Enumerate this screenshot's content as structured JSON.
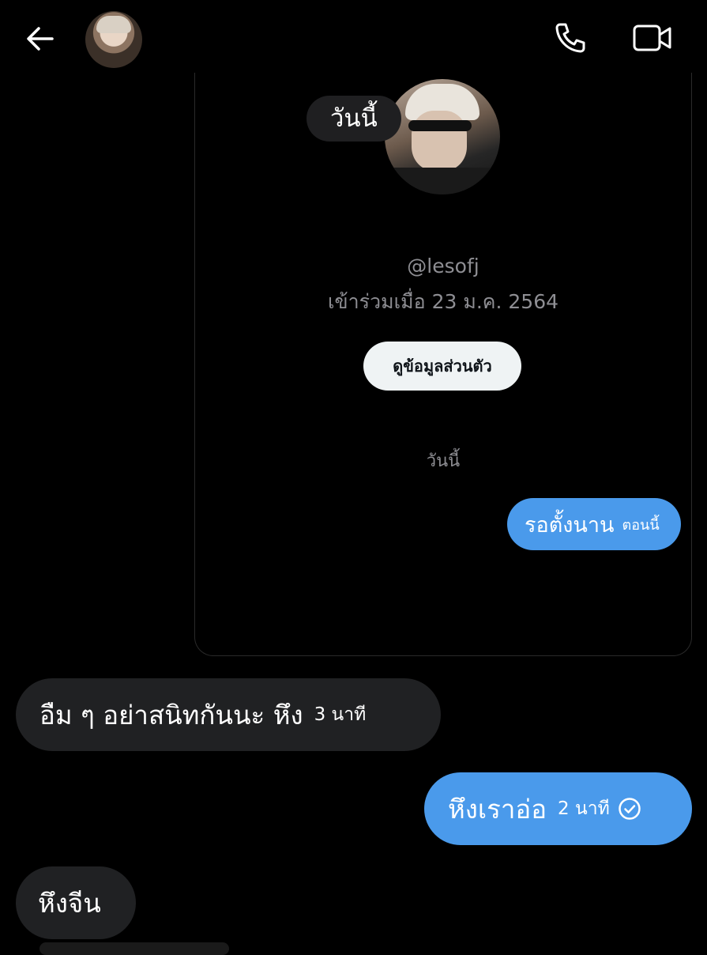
{
  "header": {
    "back_icon": "arrow-left-icon",
    "call_icon": "phone-icon",
    "video_icon": "video-camera-icon"
  },
  "profile_card": {
    "date_pill": "วันนี้",
    "handle": "@lesofj",
    "joined": "เข้าร่วมเมื่อ 23 ม.ค. 2564",
    "view_profile_label": "ดูข้อมูลส่วนตัว",
    "date_separator": "วันนี้"
  },
  "messages": [
    {
      "direction": "out",
      "text": "รอตั้งนาน",
      "time": "ตอนนี้"
    },
    {
      "direction": "in",
      "text": "อืม ๆ อย่าสนิทกันนะ หึง",
      "time": "3 นาที"
    },
    {
      "direction": "out",
      "text": "หึงเราอ่อ",
      "time": "2 นาที",
      "status_icon": "check-circle-icon"
    },
    {
      "direction": "in",
      "text": "หึงจีน"
    }
  ],
  "colors": {
    "background": "#000000",
    "outgoing_bubble": "#4a9aeb",
    "incoming_bubble": "#202123",
    "muted_text": "#8e8e93"
  }
}
